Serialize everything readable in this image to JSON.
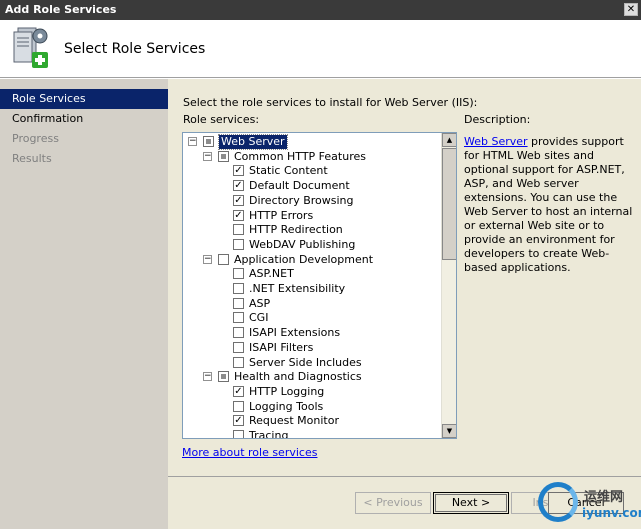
{
  "window": {
    "title": "Add Role Services",
    "close_glyph": "✕"
  },
  "banner": {
    "heading": "Select Role Services",
    "icon": "server-add-icon"
  },
  "steps": [
    {
      "label": "Role Services",
      "state": "active"
    },
    {
      "label": "Confirmation",
      "state": "normal"
    },
    {
      "label": "Progress",
      "state": "dim"
    },
    {
      "label": "Results",
      "state": "dim"
    }
  ],
  "main": {
    "instruction": "Select the role services to install for Web Server (IIS):",
    "role_services_label": "Role services:",
    "more_link": "More about role services"
  },
  "tree": [
    {
      "label": "Web Server",
      "expander": "−",
      "check": "partial",
      "selected": true
    },
    {
      "label": "Common HTTP Features",
      "expander": "−",
      "check": "partial"
    },
    {
      "label": "Static Content",
      "check": "checked"
    },
    {
      "label": "Default Document",
      "check": "checked"
    },
    {
      "label": "Directory Browsing",
      "check": "checked"
    },
    {
      "label": "HTTP Errors",
      "check": "checked"
    },
    {
      "label": "HTTP Redirection",
      "check": "unchecked"
    },
    {
      "label": "WebDAV Publishing",
      "check": "unchecked"
    },
    {
      "label": "Application Development",
      "expander": "−",
      "check": "unchecked"
    },
    {
      "label": "ASP.NET",
      "check": "unchecked"
    },
    {
      "label": ".NET Extensibility",
      "check": "unchecked"
    },
    {
      "label": "ASP",
      "check": "unchecked"
    },
    {
      "label": "CGI",
      "check": "unchecked"
    },
    {
      "label": "ISAPI Extensions",
      "check": "unchecked"
    },
    {
      "label": "ISAPI Filters",
      "check": "unchecked"
    },
    {
      "label": "Server Side Includes",
      "check": "unchecked"
    },
    {
      "label": "Health and Diagnostics",
      "expander": "−",
      "check": "partial"
    },
    {
      "label": "HTTP Logging",
      "check": "checked"
    },
    {
      "label": "Logging Tools",
      "check": "unchecked"
    },
    {
      "label": "Request Monitor",
      "check": "checked"
    },
    {
      "label": "Tracing",
      "check": "unchecked"
    }
  ],
  "description": {
    "title": "Description:",
    "link": "Web Server",
    "text": " provides support for HTML Web sites and optional support for ASP.NET, ASP, and Web server extensions. You can use the Web Server to host an internal or external Web site or to provide an environment for developers to create Web-based applications."
  },
  "buttons": {
    "previous": "< Previous",
    "next": "Next >",
    "install": "Install",
    "cancel": "Cancel"
  },
  "watermark": {
    "title": "运维网",
    "url": "iyunv.com"
  },
  "check_glyph": "✓"
}
